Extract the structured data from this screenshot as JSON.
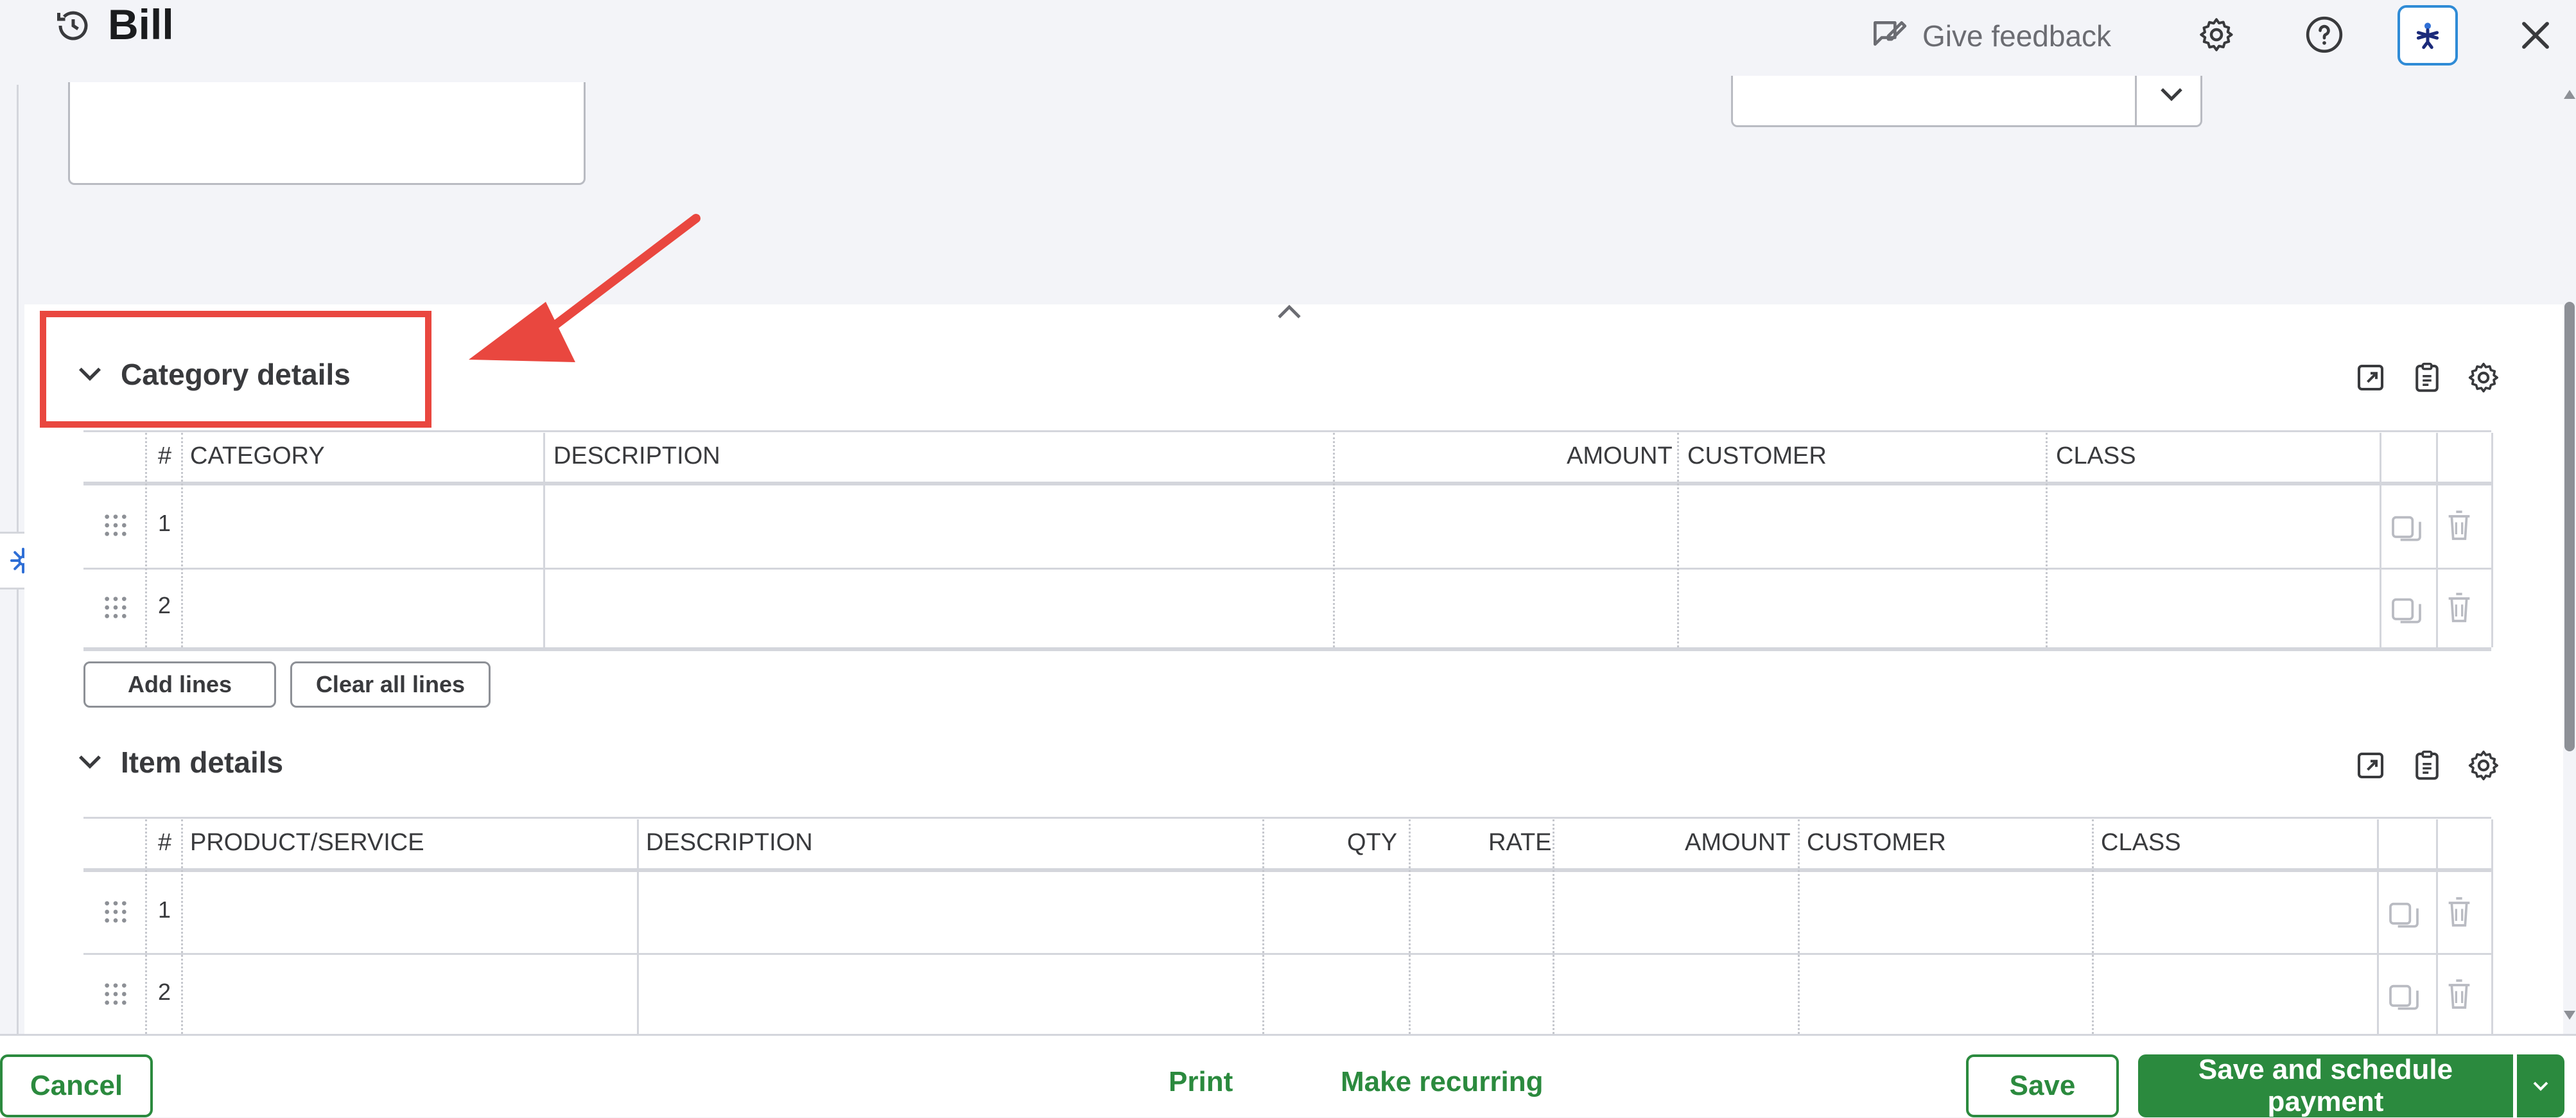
{
  "header": {
    "title": "Bill",
    "feedback_label": "Give feedback",
    "icons": [
      "history-icon",
      "feedback-icon",
      "gear-icon",
      "help-icon",
      "assistant-icon",
      "close-icon"
    ]
  },
  "category_section": {
    "title": "Category details",
    "columns": [
      "#",
      "CATEGORY",
      "DESCRIPTION",
      "AMOUNT",
      "CUSTOMER",
      "CLASS"
    ],
    "rows": [
      {
        "num": "1",
        "category": "",
        "description": "",
        "amount": "",
        "customer": "",
        "class": ""
      },
      {
        "num": "2",
        "category": "",
        "description": "",
        "amount": "",
        "customer": "",
        "class": ""
      }
    ],
    "add_lines_label": "Add lines",
    "clear_lines_label": "Clear all lines"
  },
  "item_section": {
    "title": "Item details",
    "columns": [
      "#",
      "PRODUCT/SERVICE",
      "DESCRIPTION",
      "QTY",
      "RATE",
      "AMOUNT",
      "CUSTOMER",
      "CLASS"
    ],
    "rows": [
      {
        "num": "1"
      },
      {
        "num": "2"
      }
    ]
  },
  "footer": {
    "cancel_label": "Cancel",
    "print_label": "Print",
    "recurring_label": "Make recurring",
    "save_label": "Save",
    "save_schedule_label": "Save and schedule payment"
  },
  "colors": {
    "brand_green": "#2b8a3e",
    "annotation_red": "#e9473f",
    "accent_blue": "#2f8bd6"
  }
}
